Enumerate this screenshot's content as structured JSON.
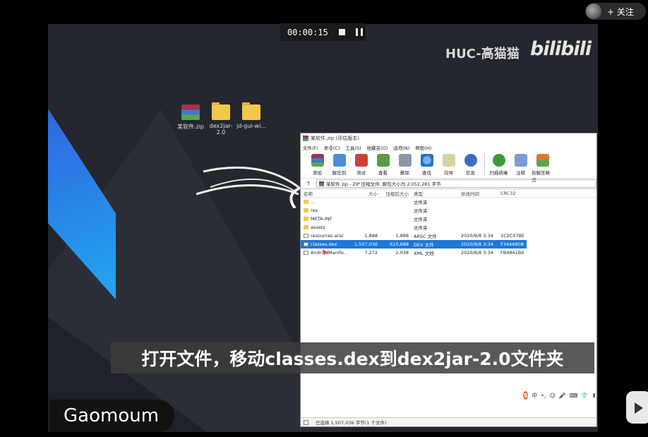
{
  "topbar": {
    "follow_label": "+ 关注"
  },
  "recorder": {
    "time": "00:00:15"
  },
  "watermark": {
    "text": "HUC-高猫猫",
    "logo_text": "bilibili"
  },
  "desktop_icons": [
    {
      "label": "某软件.zip",
      "type": "rar"
    },
    {
      "label": "dex2jar-2.0",
      "type": "folder"
    },
    {
      "label": "jd-gui-wi...",
      "type": "folder"
    }
  ],
  "window": {
    "title": "某软件.zip (评估版本)",
    "menu": [
      "文件(F)",
      "命令(C)",
      "工具(S)",
      "收藏夹(O)",
      "选项(N)",
      "帮助(H)"
    ],
    "toolbar": [
      "添加",
      "解压到",
      "测试",
      "查看",
      "删除",
      "查找",
      "向导",
      "信息",
      "扫描病毒",
      "注释",
      "自解压格式"
    ],
    "path": "某软件.zip - ZIP 压缩文件, 解包大小为 2,052,281 字节",
    "columns": [
      "名称",
      "大小",
      "压缩后大小",
      "类型",
      "修改时间",
      "CRC32"
    ],
    "rows": [
      {
        "name": "..",
        "size": "",
        "psize": "",
        "type": "文件夹",
        "mtime": "",
        "crc": "",
        "kind": "folder"
      },
      {
        "name": "res",
        "size": "",
        "psize": "",
        "type": "文件夹",
        "mtime": "",
        "crc": "",
        "kind": "folder"
      },
      {
        "name": "META-INF",
        "size": "",
        "psize": "",
        "type": "文件夹",
        "mtime": "",
        "crc": "",
        "kind": "folder"
      },
      {
        "name": "assets",
        "size": "",
        "psize": "",
        "type": "文件夹",
        "mtime": "",
        "crc": "",
        "kind": "folder"
      },
      {
        "name": "resources.arsc",
        "size": "1,888",
        "psize": "1,888",
        "type": "ARSC 文件",
        "mtime": "2020/8/8 3:34",
        "crc": "1C2C078E",
        "kind": "file"
      },
      {
        "name": "classes.dex",
        "size": "1,507,036",
        "psize": "610,688",
        "type": "DEX 文件",
        "mtime": "2020/8/8 3:34",
        "crc": "F34A6808",
        "kind": "file",
        "selected": true
      },
      {
        "name": "AndroidManife...",
        "size": "7,272",
        "psize": "2,038",
        "type": "XML 文档",
        "mtime": "2020/8/8 3:34",
        "crc": "FB4841B0",
        "kind": "file"
      }
    ],
    "status": "已选择 1,507,036 字节(1 个文件)"
  },
  "ime": {
    "items": [
      "S",
      "中",
      "•,",
      "☺",
      "🎤",
      "⌨",
      "👕",
      "⬆"
    ]
  },
  "subtitle": "打开文件，移动classes.dex到dex2jar-2.0文件夹",
  "name_tag": "Gaomoum",
  "colors": {
    "selection": "#1e78d7",
    "desktop": "#24272e",
    "accent_blue": "#2f66e0"
  }
}
